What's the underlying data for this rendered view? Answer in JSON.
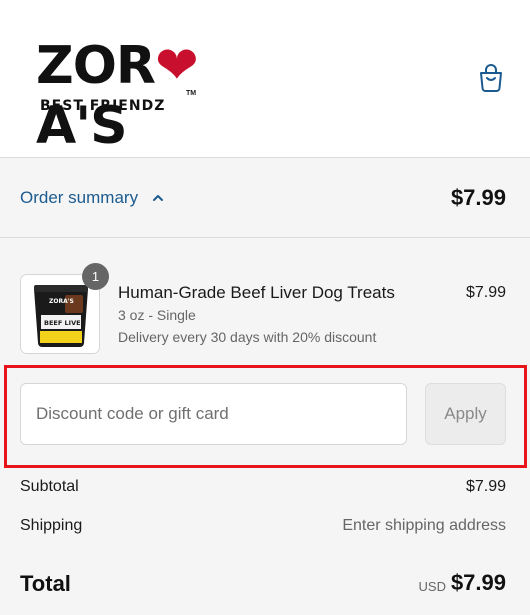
{
  "header": {
    "logo_main_before": "ZOR",
    "logo_main_after": "A'S",
    "logo_sub": "BEST FRIENDZ",
    "logo_tm": "TM",
    "cart_icon": "shopping-bag-icon"
  },
  "summary": {
    "label": "Order summary",
    "total": "$7.99",
    "toggle_icon": "chevron-up-icon"
  },
  "product": {
    "quantity": "1",
    "title": "Human-Grade Beef Liver Dog Treats",
    "variant": "3 oz - Single",
    "delivery": "Delivery every 30 days with 20% discount",
    "price": "$7.99",
    "image_brand": "ZORA'S",
    "image_label": "BEEF LIVER"
  },
  "discount": {
    "placeholder": "Discount code or gift card",
    "apply_label": "Apply"
  },
  "totals": {
    "subtotal_label": "Subtotal",
    "subtotal_value": "$7.99",
    "shipping_label": "Shipping",
    "shipping_value": "Enter shipping address",
    "total_label": "Total",
    "currency": "USD",
    "total_value": "$7.99"
  },
  "colors": {
    "accent_link": "#1c5b8f",
    "highlight": "#e8141b",
    "heart": "#c8102e"
  }
}
